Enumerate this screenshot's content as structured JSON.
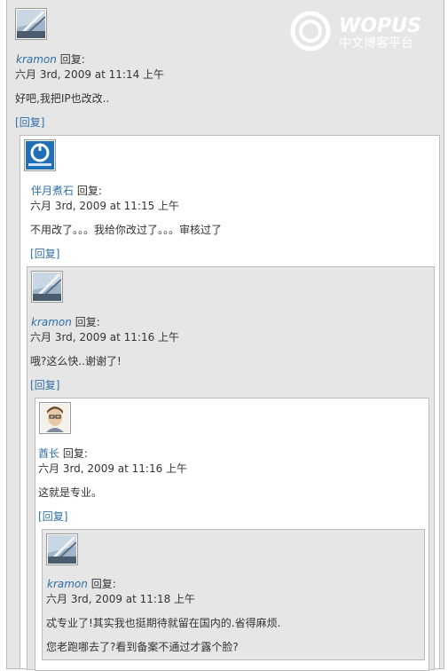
{
  "brand": {
    "name": "WOPUS",
    "subtitle": "中文博客平台"
  },
  "reply_link_label": "回复",
  "comments": [
    {
      "author": "kramon",
      "said": "回复:",
      "date": "六月 3rd, 2009 at 11:14 上午",
      "text": "好吧,我把IP也改改.."
    },
    {
      "author": "伴月煮石",
      "said": "回复:",
      "date": "六月 3rd, 2009 at 11:15 上午",
      "text": "不用改了。。。我给你改过了。。。审核过了"
    },
    {
      "author": "kramon",
      "said": "回复:",
      "date": "六月 3rd, 2009 at 11:16 上午",
      "text": "哦?这么快..谢谢了!"
    },
    {
      "author": "酋长",
      "said": "回复:",
      "date": "六月 3rd, 2009 at 11:16 上午",
      "text": "这就是专业。"
    },
    {
      "author": "kramon",
      "said": "回复:",
      "date": "六月 3rd, 2009 at 11:18 上午",
      "text": "忒专业了!其实我也挺期待就留在国内的.省得麻烦.",
      "text2": "您老跑哪去了?看到备案不通过才露个脸?"
    }
  ]
}
